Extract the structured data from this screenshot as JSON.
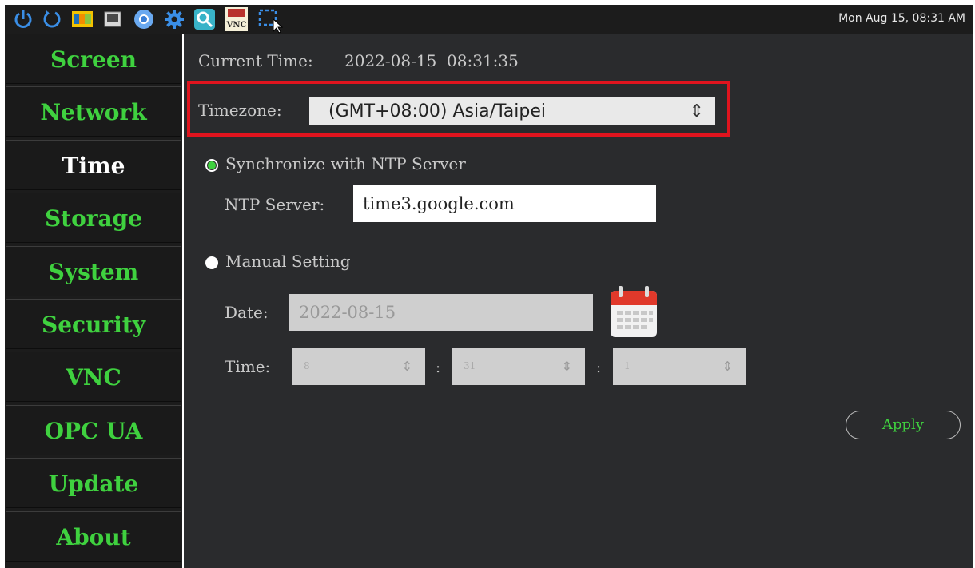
{
  "taskbar": {
    "icons": [
      "power-icon",
      "refresh-icon",
      "nxp-icon",
      "monitor-icon",
      "chromium-icon",
      "gear-icon",
      "search-app-icon",
      "tightvnc-icon",
      "screenshot-select-icon"
    ],
    "vnc_icon_text": "VNC",
    "clock": "Mon Aug 15, 08:31 AM"
  },
  "sidebar": {
    "items": [
      {
        "label": "Screen"
      },
      {
        "label": "Network"
      },
      {
        "label": "Time",
        "active": true
      },
      {
        "label": "Storage"
      },
      {
        "label": "System"
      },
      {
        "label": "Security"
      },
      {
        "label": "VNC"
      },
      {
        "label": "OPC UA"
      },
      {
        "label": "Update"
      },
      {
        "label": "About"
      }
    ]
  },
  "time_page": {
    "current_time_label": "Current Time:",
    "current_time_value": "2022-08-15  08:31:35",
    "timezone_label": "Timezone:",
    "timezone_value": "(GMT+08:00) Asia/Taipei",
    "ntp_option_label": "Synchronize with NTP Server",
    "ntp_selected": true,
    "ntp_server_label": "NTP Server:",
    "ntp_server_value": "time3.google.com",
    "manual_option_label": "Manual Setting",
    "date_label": "Date:",
    "date_value": "2022-08-15",
    "time_label": "Time:",
    "hour": "8",
    "minute": "31",
    "second": "1",
    "separator": ":",
    "apply_label": "Apply"
  },
  "colors": {
    "accent_green": "#3fd13f",
    "highlight_red": "#e0141e",
    "panel_bg": "#2a2b2d"
  }
}
